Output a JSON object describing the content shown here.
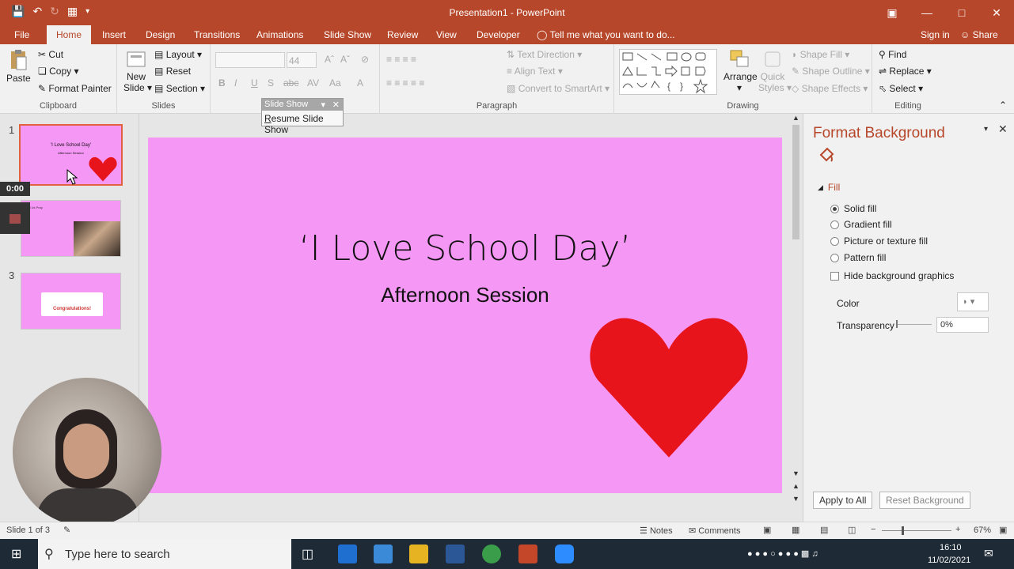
{
  "window": {
    "title": "Presentation1 - PowerPoint"
  },
  "tabs": [
    "File",
    "Home",
    "Insert",
    "Design",
    "Transitions",
    "Animations",
    "Slide Show",
    "Review",
    "View",
    "Developer"
  ],
  "tell_me": "Tell me what you want to do...",
  "account": {
    "sign_in": "Sign in",
    "share": "Share"
  },
  "ribbon": {
    "clipboard": {
      "label": "Clipboard",
      "paste": "Paste",
      "cut": "Cut",
      "copy": "Copy",
      "format_painter": "Format Painter"
    },
    "slides": {
      "label": "Slides",
      "new_slide_1": "New",
      "new_slide_2": "Slide",
      "layout": "Layout",
      "reset": "Reset",
      "section": "Section"
    },
    "font": {
      "size": "44"
    },
    "paragraph": {
      "label": "Paragraph",
      "text_direction": "Text Direction",
      "align_text": "Align Text",
      "convert_smartart": "Convert to SmartArt"
    },
    "drawing": {
      "label": "Drawing",
      "arrange": "Arrange",
      "quick_styles_1": "Quick",
      "quick_styles_2": "Styles",
      "shape_fill": "Shape Fill",
      "shape_outline": "Shape Outline",
      "shape_effects": "Shape Effects"
    },
    "editing": {
      "label": "Editing",
      "find": "Find",
      "replace": "Replace",
      "select": "Select"
    }
  },
  "slideshow_toolbar": {
    "title": "Slide Show",
    "resume": "Resume Slide Show"
  },
  "recording": {
    "timer": "0:00"
  },
  "thumbnails": [
    {
      "number": "1",
      "title": "'I Love School Day'",
      "subtitle": "Afternoon Session"
    },
    {
      "number": "2",
      "title": "Let Us Pray"
    },
    {
      "number": "3",
      "banner": "Congratulations!"
    }
  ],
  "slide": {
    "title": "‘I Love School Day’",
    "subtitle": "Afternoon Session",
    "background": "#f597f5",
    "heart_color": "#e8141c"
  },
  "format_background": {
    "title": "Format Background",
    "section": "Fill",
    "options": [
      "Solid fill",
      "Gradient fill",
      "Picture or texture fill",
      "Pattern fill"
    ],
    "selected": "Solid fill",
    "hide_graphics": "Hide background graphics",
    "color_label": "Color",
    "transparency_label": "Transparency",
    "transparency_value": "0%",
    "apply_all": "Apply to All",
    "reset": "Reset Background"
  },
  "status": {
    "slide": "Slide 1 of 3",
    "notes": "Notes",
    "comments": "Comments",
    "zoom": "67%"
  },
  "taskbar": {
    "search_placeholder": "Type here to search",
    "time": "16:10",
    "date": "11/02/2021"
  },
  "colors": {
    "accent": "#b7472a",
    "slide_bg": "#f597f5",
    "heart": "#e8141c"
  }
}
